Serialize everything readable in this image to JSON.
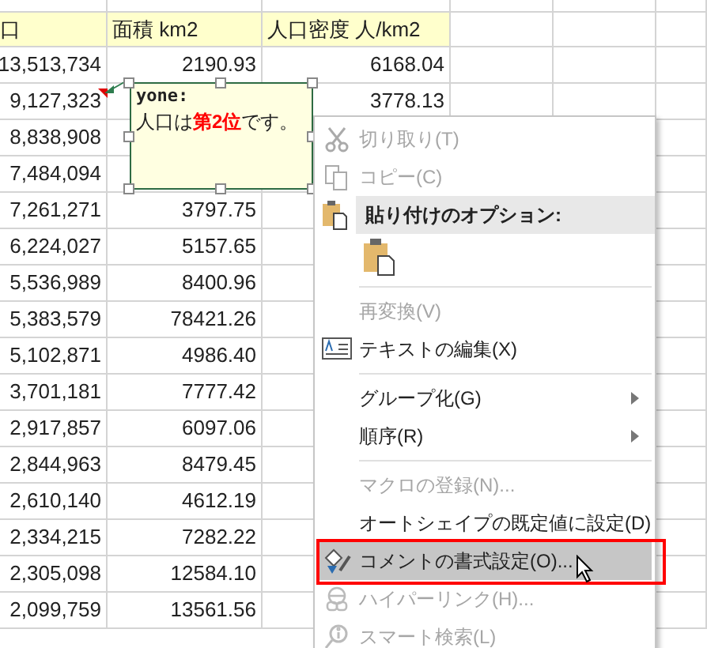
{
  "sheet": {
    "columns": [
      "口",
      "面積 km2",
      "人口密度 人/km2"
    ],
    "rows": [
      [
        "13,513,734",
        "2190.93",
        "6168.04"
      ],
      [
        "9,127,323",
        "",
        "3778.13"
      ],
      [
        "8,838,908",
        "",
        ""
      ],
      [
        "7,484,094",
        "",
        ""
      ],
      [
        "7,261,271",
        "3797.75",
        ""
      ],
      [
        "6,224,027",
        "5157.65",
        ""
      ],
      [
        "5,536,989",
        "8400.96",
        ""
      ],
      [
        "5,383,579",
        "78421.26",
        ""
      ],
      [
        "5,102,871",
        "4986.40",
        ""
      ],
      [
        "3,701,181",
        "7777.42",
        ""
      ],
      [
        "2,917,857",
        "6097.06",
        ""
      ],
      [
        "2,844,963",
        "8479.45",
        ""
      ],
      [
        "2,610,140",
        "4612.19",
        ""
      ],
      [
        "2,334,215",
        "7282.22",
        ""
      ],
      [
        "2,305,098",
        "12584.10",
        ""
      ],
      [
        "2,099,759",
        "13561.56",
        ""
      ]
    ]
  },
  "comment": {
    "author": "yone:",
    "text": "人口は**第2位**です。"
  },
  "context_menu": [
    {
      "kind": "item",
      "label": "切り取り(T)",
      "disabled": true,
      "submenu": false,
      "highlighted": false
    },
    {
      "kind": "item",
      "label": "コピー(C)",
      "disabled": true,
      "submenu": false,
      "highlighted": false
    },
    {
      "kind": "header",
      "label": "貼り付けのオプション:"
    },
    {
      "kind": "paste-options"
    },
    {
      "kind": "separator"
    },
    {
      "kind": "item",
      "label": "再変換(V)",
      "disabled": true,
      "submenu": false,
      "highlighted": false
    },
    {
      "kind": "item",
      "label": "テキストの編集(X)",
      "disabled": false,
      "submenu": false,
      "highlighted": false
    },
    {
      "kind": "separator"
    },
    {
      "kind": "item",
      "label": "グループ化(G)",
      "disabled": false,
      "submenu": true,
      "highlighted": false
    },
    {
      "kind": "item",
      "label": "順序(R)",
      "disabled": false,
      "submenu": true,
      "highlighted": false
    },
    {
      "kind": "separator"
    },
    {
      "kind": "item",
      "label": "マクロの登録(N)...",
      "disabled": true,
      "submenu": false,
      "highlighted": false
    },
    {
      "kind": "item",
      "label": "オートシェイプの既定値に設定(D)",
      "disabled": false,
      "submenu": false,
      "highlighted": false
    },
    {
      "kind": "item",
      "label": "コメントの書式設定(O)...",
      "disabled": false,
      "submenu": false,
      "highlighted": true
    },
    {
      "kind": "item",
      "label": "ハイパーリンク(H)...",
      "disabled": true,
      "submenu": false,
      "highlighted": false
    },
    {
      "kind": "item",
      "label": "スマート検索(L)",
      "disabled": true,
      "submenu": false,
      "highlighted": false
    }
  ]
}
